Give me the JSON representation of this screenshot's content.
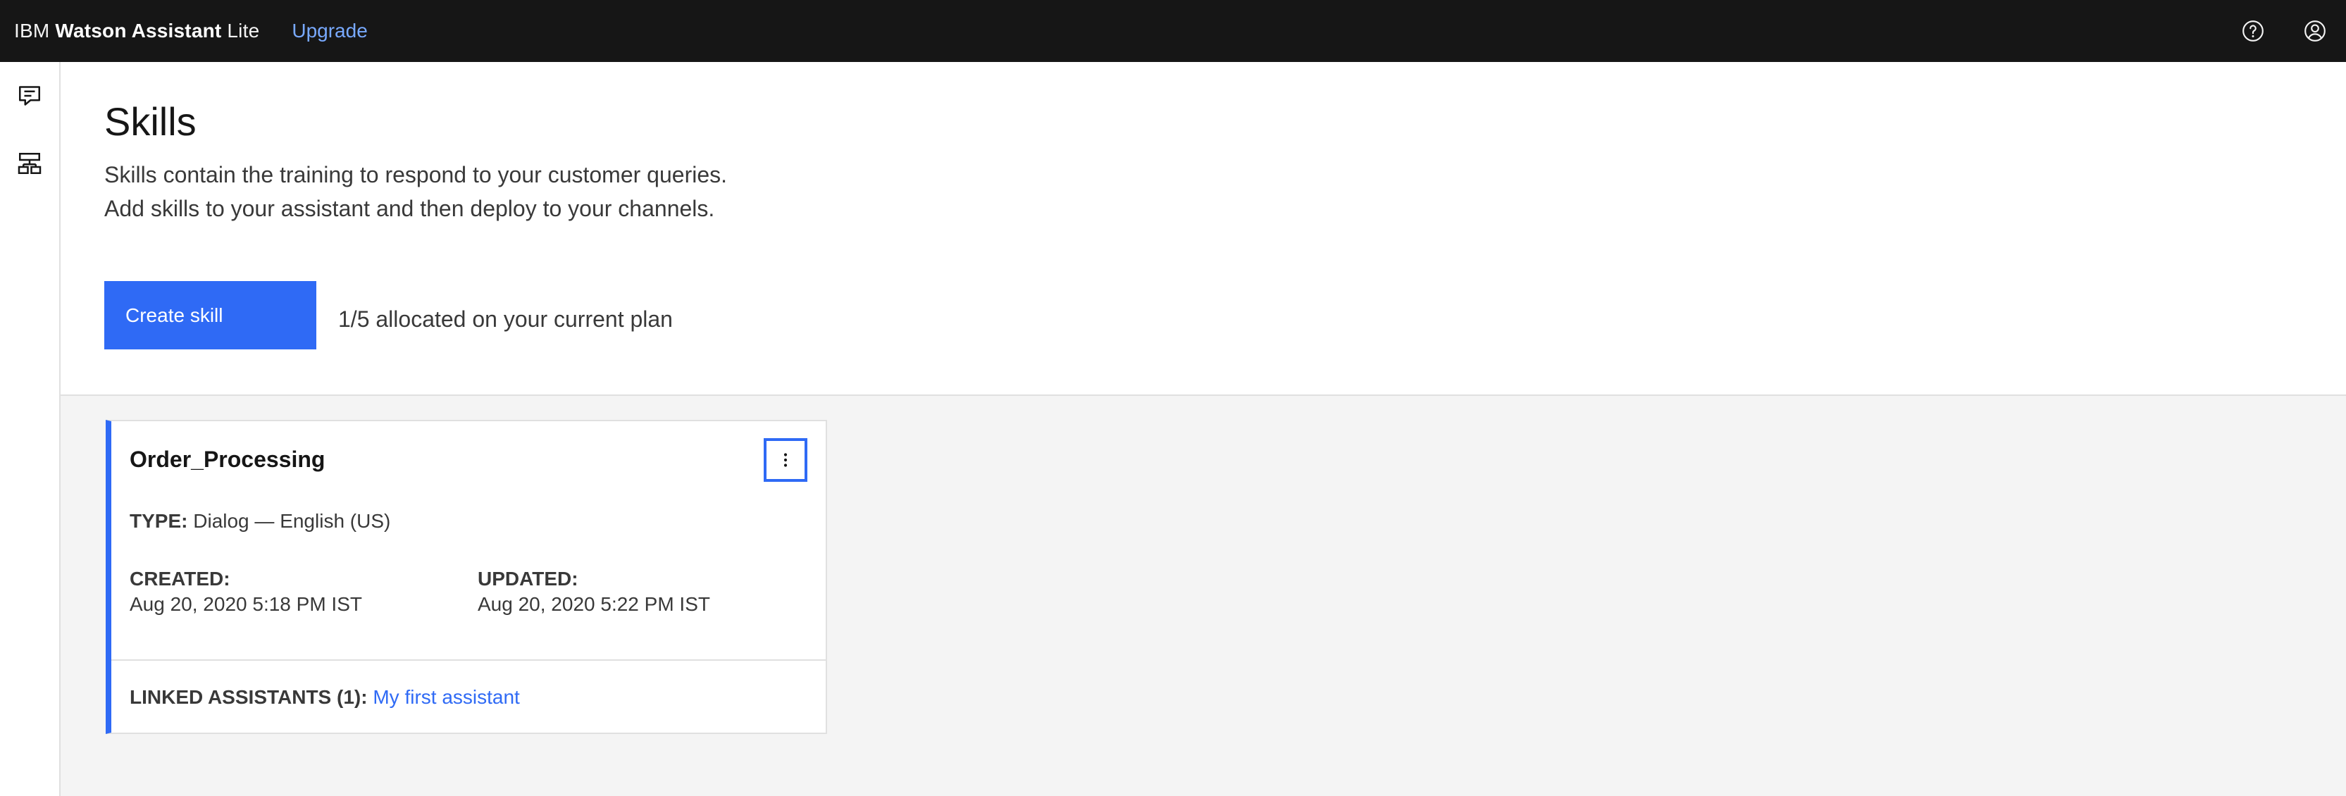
{
  "topbar": {
    "brand_prefix": "IBM",
    "brand_name": "Watson Assistant",
    "brand_plan": "Lite",
    "upgrade_label": "Upgrade",
    "icons": [
      "help-icon",
      "user-avatar-icon"
    ]
  },
  "siderail": {
    "items": [
      {
        "icon": "assistants-chat-icon"
      },
      {
        "icon": "skills-tree-icon"
      }
    ]
  },
  "header": {
    "title": "Skills",
    "description": "Skills contain the training to respond to your customer queries. Add skills to your assistant and then deploy to your channels.",
    "create_button_label": "Create skill",
    "allocation_text": "1/5 allocated on your current plan"
  },
  "skill_card": {
    "name": "Order_Processing",
    "type_label": "TYPE:",
    "type_value": "Dialog — English (US)",
    "created_label": "CREATED:",
    "created_value": "Aug 20, 2020 5:18 PM IST",
    "updated_label": "UPDATED:",
    "updated_value": "Aug 20, 2020 5:22 PM IST",
    "linked_label": "LINKED ASSISTANTS (1):",
    "linked_value": "My first assistant"
  },
  "colors": {
    "topbar_bg": "#161616",
    "accent_blue": "#2f6af5",
    "link_blue_on_dark": "#78a9ff",
    "content_bg": "#f4f4f4"
  }
}
